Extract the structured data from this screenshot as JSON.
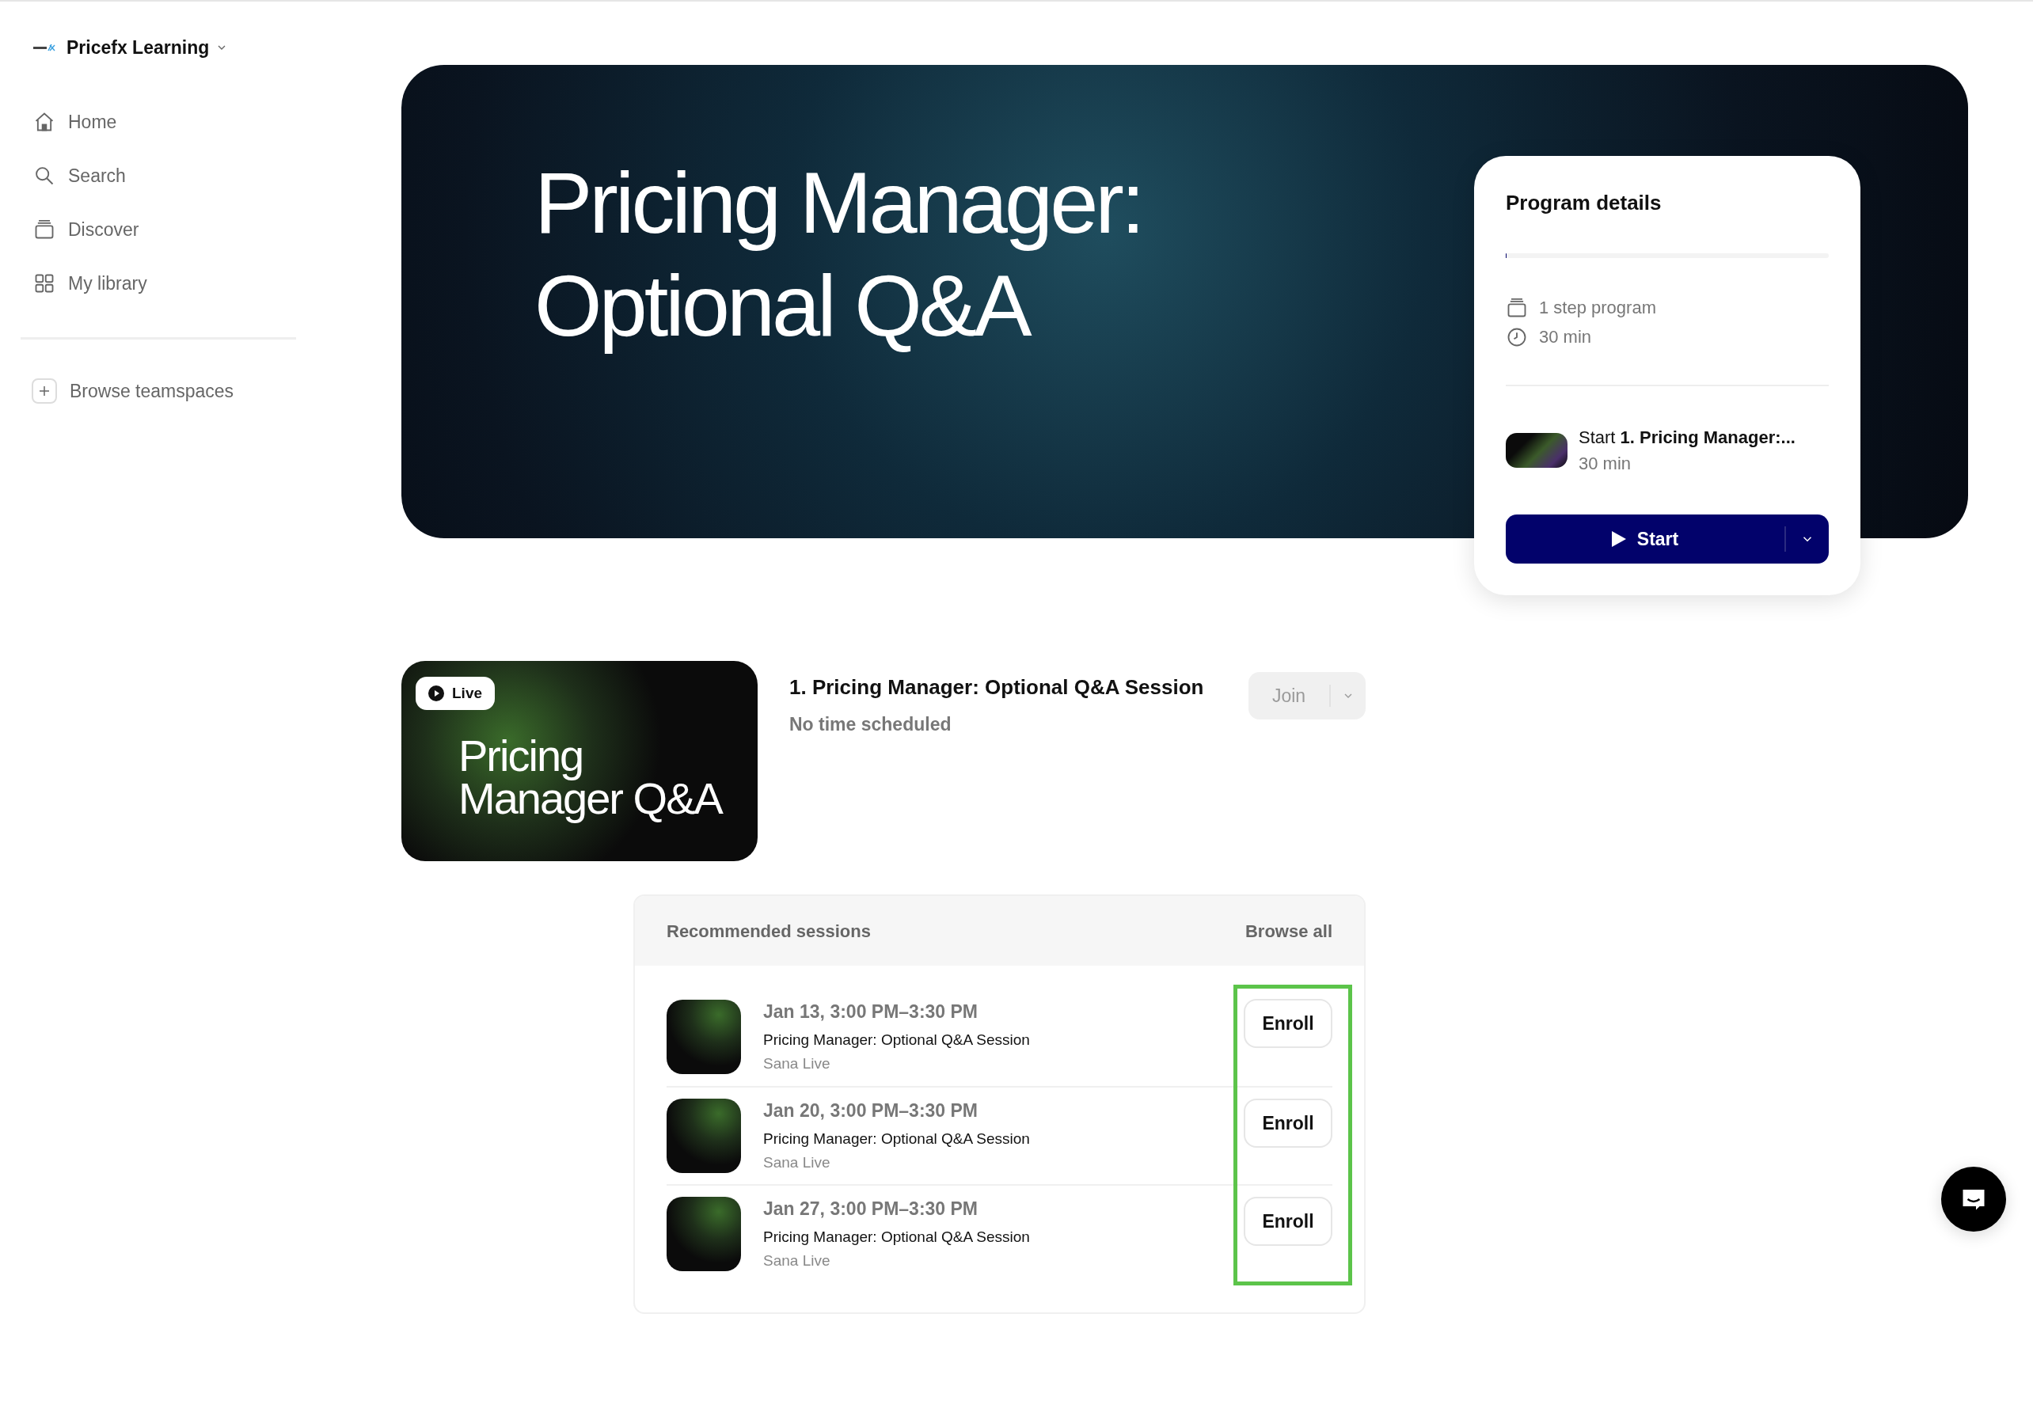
{
  "sidebar": {
    "brand": "Pricefx Learning",
    "items": [
      {
        "label": "Home",
        "kind": "home",
        "selected": false
      },
      {
        "label": "Search",
        "kind": "search",
        "selected": false
      },
      {
        "label": "Discover",
        "kind": "discover",
        "selected": false
      },
      {
        "label": "My library",
        "kind": "library",
        "selected": false
      }
    ],
    "browse": "Browse teamspaces"
  },
  "hero": {
    "title": "Pricing Manager: Optional Q&A"
  },
  "program": {
    "title": "Program details",
    "level": 0,
    "steps": "1 step program",
    "duration": "30 min",
    "next_prefix": "Start",
    "next_title": "1. Pricing Manager:...",
    "next_duration": "30 min",
    "start_label": "Start"
  },
  "session": {
    "badge": "Live",
    "thumb_text": "Pricing Manager Q&A",
    "title": "1. Pricing Manager: Optional Q&A Session",
    "time": "No time scheduled",
    "join_label": "Join",
    "join_disabled": true
  },
  "recommended": {
    "title": "Recommended sessions",
    "browse": "Browse all",
    "rows": [
      {
        "date": "Jan 13, 3:00 PM–3:30 PM",
        "title": "Pricing Manager: Optional Q&A Session",
        "host": "Sana Live",
        "action": "Enroll"
      },
      {
        "date": "Jan 20, 3:00 PM–3:30 PM",
        "title": "Pricing Manager: Optional Q&A Session",
        "host": "Sana Live",
        "action": "Enroll"
      },
      {
        "date": "Jan 27, 3:00 PM–3:30 PM",
        "title": "Pricing Manager: Optional Q&A Session",
        "host": "Sana Live",
        "action": "Enroll"
      }
    ]
  }
}
